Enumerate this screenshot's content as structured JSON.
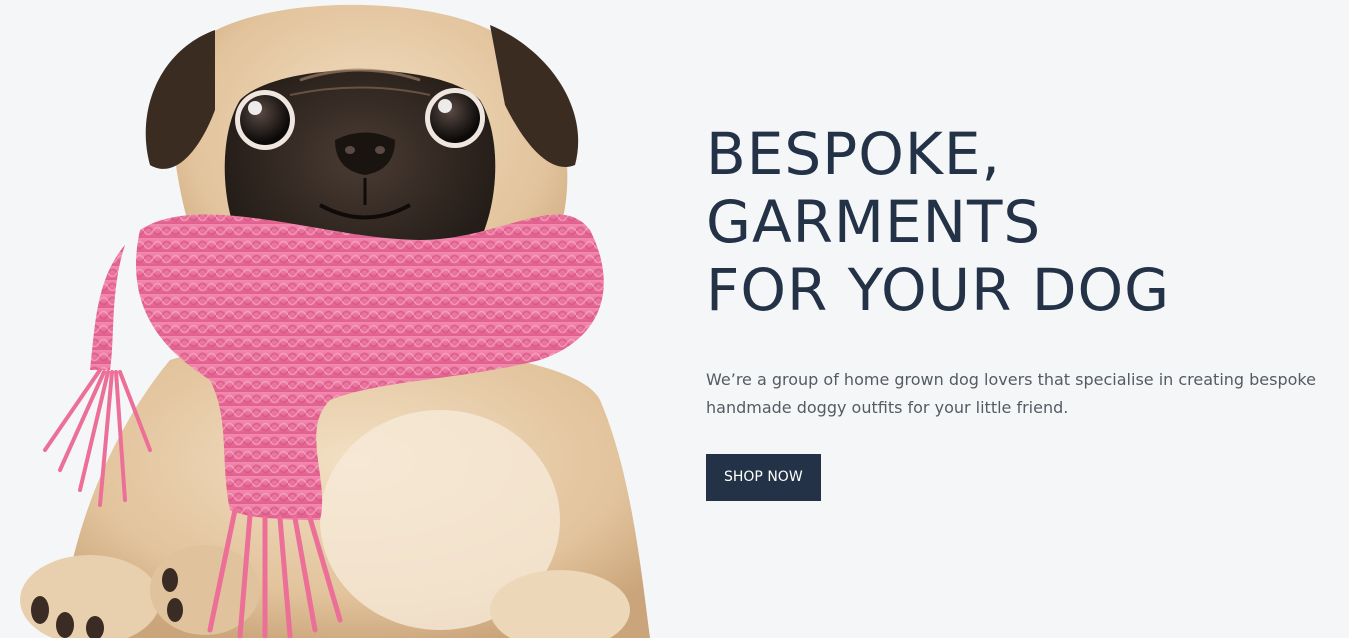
{
  "hero": {
    "title_lines": [
      "BESPOKE,",
      "GARMENTS",
      "FOR YOUR DOG"
    ],
    "description": "We’re a group of home grown dog lovers that specialise in creating bespoke handmade doggy outfits for your little friend.",
    "cta_label": "SHOP NOW",
    "image_icon": "pug-with-pink-scarf"
  },
  "colors": {
    "background": "#f5f6f8",
    "heading": "#233246",
    "body_text": "#555b63",
    "button_bg": "#233246",
    "button_text": "#ffffff",
    "scarf": "#ec6f98"
  }
}
